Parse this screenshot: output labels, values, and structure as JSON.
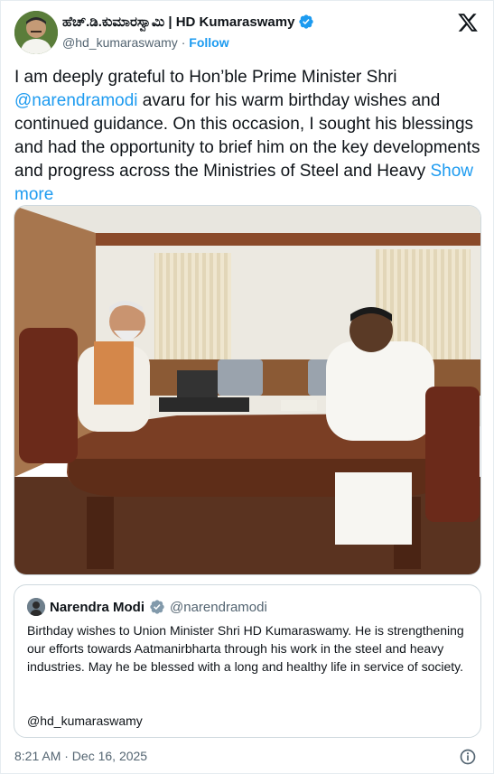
{
  "author": {
    "display_name": "ಹೆಚ್.ಡಿ.ಕುಮಾರಸ್ವಾಮಿ | HD Kumaraswamy",
    "handle": "@hd_kumaraswamy",
    "separator": " · ",
    "follow_label": "Follow"
  },
  "tweet": {
    "text_before": "I am deeply grateful to Hon’ble Prime Minister Shri ",
    "mention": "@narendramodi",
    "text_after": " avaru for his warm birthday wishes and continued guidance. On this occasion, I sought his blessings and had the opportunity to brief him on the key developments and progress across the Ministries of Steel and Heavy ",
    "show_more_label": "Show more"
  },
  "quoted_tweet": {
    "name": "Narendra Modi",
    "handle": "@narendramodi",
    "text": "Birthday wishes to Union Minister Shri HD Kumaraswamy. He is strengthening our efforts towards Aatmanirbharta through his work in the steel and heavy industries. May he be blessed with a long and healthy life in service of society.",
    "mention": "@hd_kumaraswamy"
  },
  "footer": {
    "timestamp": "8:21 AM · Dec 16, 2025"
  },
  "colors": {
    "accent": "#1d9bf0",
    "text": "#0f1419",
    "muted": "#536471",
    "border": "#cfd9de"
  },
  "icons": [
    "verified-badge-icon",
    "x-logo-icon",
    "info-icon"
  ]
}
